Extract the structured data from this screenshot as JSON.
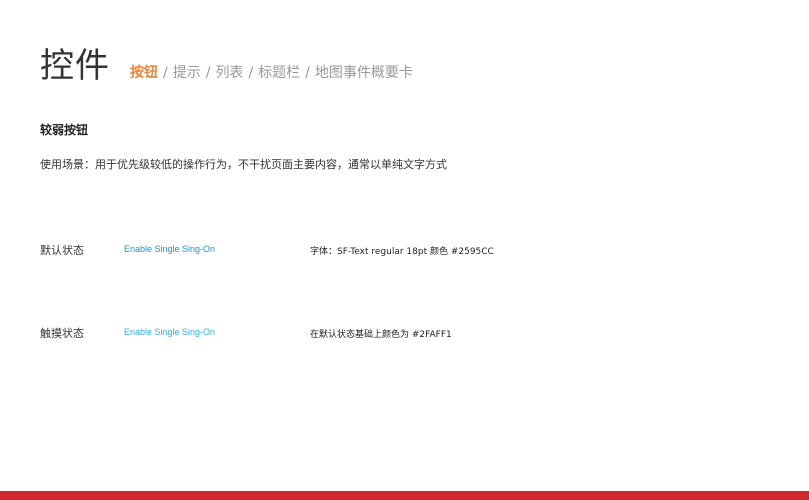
{
  "header": {
    "title": "控件",
    "breadcrumb": [
      {
        "label": "按钮",
        "active": true
      },
      {
        "label": "提示",
        "active": false
      },
      {
        "label": "列表",
        "active": false
      },
      {
        "label": "标题栏",
        "active": false
      },
      {
        "label": "地图事件概要卡",
        "active": false
      }
    ],
    "separator": "/"
  },
  "section": {
    "title": "较弱按钮",
    "usage": "使用场景：用于优先级较低的操作行为，不干扰页面主要内容，通常以单纯文字方式"
  },
  "states": [
    {
      "label": "默认状态",
      "button_text": "Enable Single Sing-On",
      "note": "字体：SF-Text regular 18pt 颜色 #2595CC",
      "color": "#2595CC"
    },
    {
      "label": "触摸状态",
      "button_text": "Enable Single Sing-On",
      "note": "在默认状态基础上颜色为 #2FAFF1",
      "color": "#2FAFF1"
    }
  ],
  "colors": {
    "accent": "#E8873A",
    "bottom_bar": "#D0282F"
  }
}
